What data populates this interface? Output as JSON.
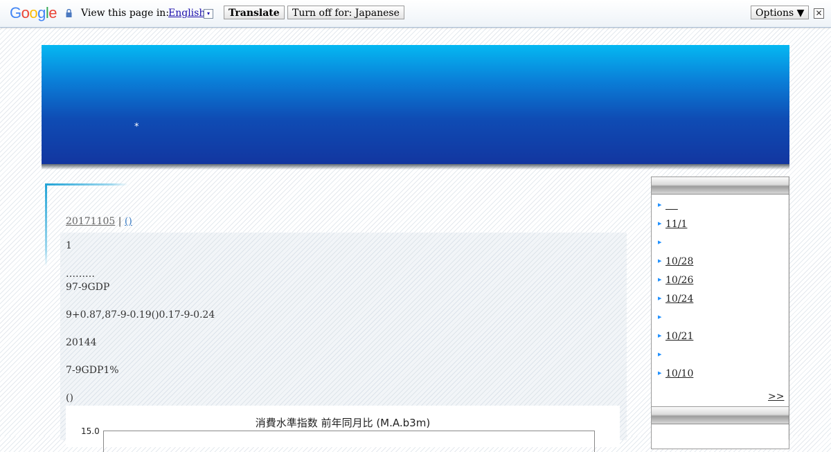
{
  "translate_bar": {
    "logo": "Google",
    "prompt": "View this page in:",
    "language": "English",
    "dropdown_glyph": "▾",
    "translate_label": "Translate",
    "turn_off_label": "Turn off for: Japanese",
    "options_label": "Options ▼",
    "close_glyph": "✕"
  },
  "header": {
    "mark": "*"
  },
  "entry": {
    "date": "20171105",
    "separator": "|",
    "category": "()",
    "lines": [
      "1",
      "………",
      "97-9GDP",
      "9+0.87,87-9-0.19()0.17-9-0.24",
      "20144",
      "7-9GDP1%",
      "()"
    ],
    "chart": {
      "title": "消費水準指数 前年同月比 (M.A.b3m)",
      "y_tick": "15.0"
    }
  },
  "sidebar": {
    "items": [
      {
        "label": ""
      },
      {
        "label": "11/1"
      },
      {
        "label": ""
      },
      {
        "label": "10/28"
      },
      {
        "label": "10/26"
      },
      {
        "label": "10/24"
      },
      {
        "label": ""
      },
      {
        "label": "10/21"
      },
      {
        "label": ""
      },
      {
        "label": "10/10"
      }
    ],
    "more": ">>"
  },
  "colors": {
    "header_top": "#05b8f2",
    "header_bottom": "#1236a0",
    "link_blue": "#1a0dab",
    "bullet": "#1e90ff"
  }
}
